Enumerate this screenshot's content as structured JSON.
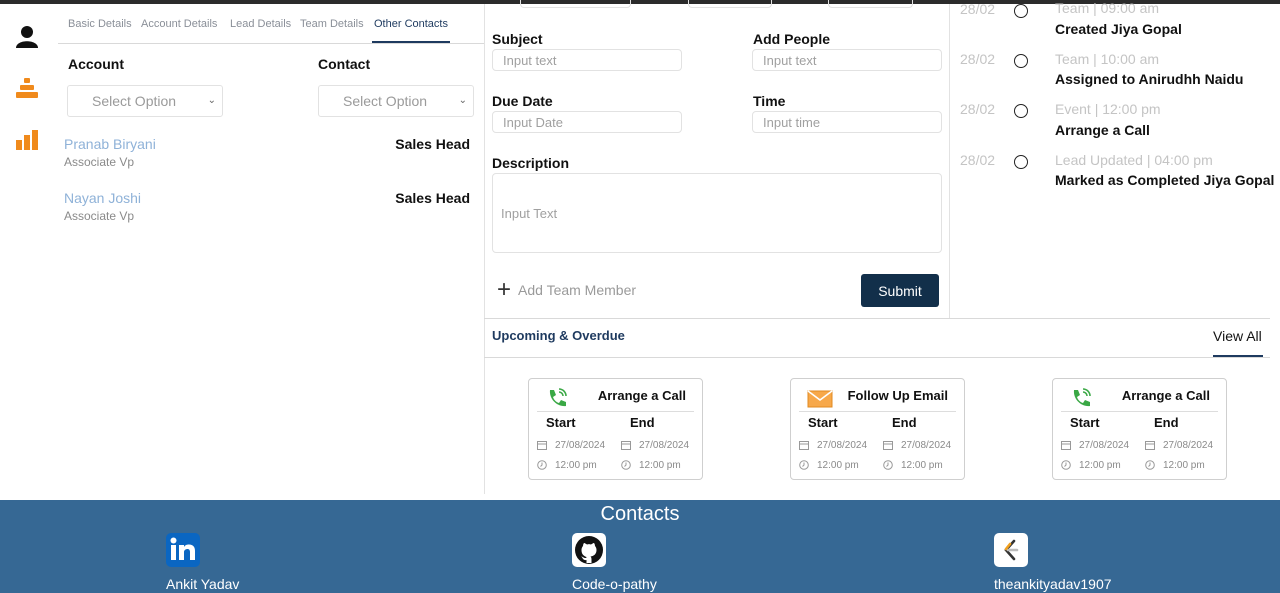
{
  "tabs": [
    "Basic Details",
    "Account Details",
    "Lead Details",
    "Team Details",
    "Other Contacts"
  ],
  "active_tab": "Other Contacts",
  "left": {
    "account_label": "Account",
    "contact_label": "Contact",
    "account_select": "Select Option",
    "contact_select": "Select Option",
    "contacts": [
      {
        "name": "Pranab Biryani",
        "role": "Associate Vp",
        "title": "Sales Head"
      },
      {
        "name": "Nayan Joshi",
        "role": "Associate Vp",
        "title": "Sales Head"
      }
    ]
  },
  "form": {
    "subject_label": "Subject",
    "subject_placeholder": "Input text",
    "people_label": "Add People",
    "people_placeholder": "Input text",
    "due_label": "Due Date",
    "due_placeholder": "Input Date",
    "time_label": "Time",
    "time_placeholder": "Input time",
    "desc_label": "Description",
    "desc_placeholder": "Input Text",
    "add_member": "Add Team Member",
    "submit": "Submit"
  },
  "timeline": [
    {
      "date": "28/02",
      "meta": "Team | 09:00 am",
      "title": "Created Jiya Gopal"
    },
    {
      "date": "28/02",
      "meta": "Team | 10:00 am",
      "title": "Assigned to Anirudhh Naidu"
    },
    {
      "date": "28/02",
      "meta": "Event | 12:00 pm",
      "title": "Arrange a Call"
    },
    {
      "date": "28/02",
      "meta": "Lead Updated | 04:00 pm",
      "title": "Marked as Completed Jiya Gopal"
    }
  ],
  "upcoming": {
    "title": "Upcoming & Overdue",
    "view_all": "View All",
    "cards": [
      {
        "title": "Arrange a Call",
        "icon": "phone-icon",
        "start": "Start",
        "end": "End",
        "start_date": "27/08/2024",
        "end_date": "27/08/2024",
        "start_time": "12:00 pm",
        "end_time": "12:00 pm"
      },
      {
        "title": "Follow Up Email",
        "icon": "envelope-icon",
        "start": "Start",
        "end": "End",
        "start_date": "27/08/2024",
        "end_date": "27/08/2024",
        "start_time": "12:00 pm",
        "end_time": "12:00 pm"
      },
      {
        "title": "Arrange a Call",
        "icon": "phone-icon",
        "start": "Start",
        "end": "End",
        "start_date": "27/08/2024",
        "end_date": "27/08/2024",
        "start_time": "12:00 pm",
        "end_time": "12:00 pm"
      }
    ]
  },
  "footer": {
    "title": "Contacts",
    "links": [
      {
        "label": "Ankit Yadav",
        "icon": "linkedin-icon"
      },
      {
        "label": "Code-o-pathy",
        "icon": "github-icon"
      },
      {
        "label": "theankityadav1907",
        "icon": "leetcode-icon"
      }
    ]
  },
  "colors": {
    "accent": "#1e3a5f",
    "submit": "#122f4a",
    "footer": "#366894",
    "link": "#8fb2d8",
    "orange": "#f08a1c",
    "green": "#3aa845"
  }
}
